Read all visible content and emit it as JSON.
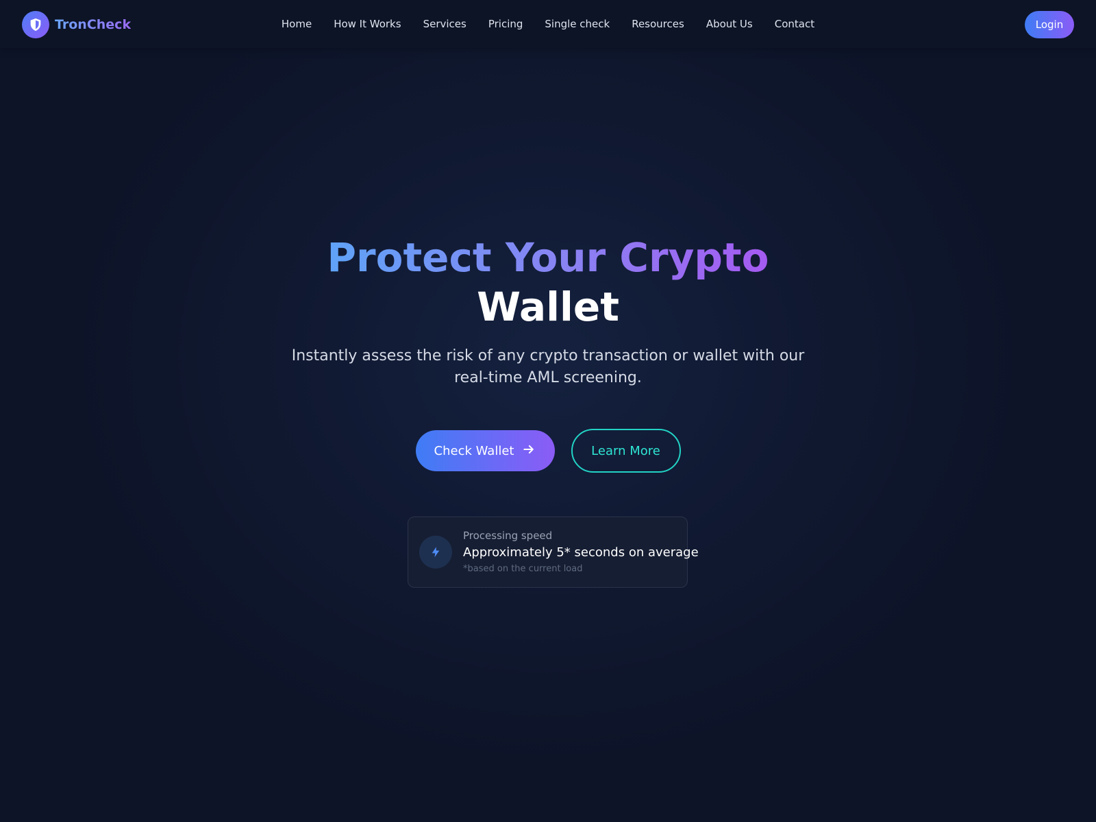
{
  "brand": {
    "name": "TronCheck"
  },
  "nav": {
    "links": [
      {
        "label": "Home"
      },
      {
        "label": "How It Works"
      },
      {
        "label": "Services"
      },
      {
        "label": "Pricing"
      },
      {
        "label": "Single check"
      },
      {
        "label": "Resources"
      },
      {
        "label": "About Us"
      },
      {
        "label": "Contact"
      }
    ],
    "login_label": "Login"
  },
  "hero": {
    "title_line1": "Protect Your Crypto",
    "title_line2": "Wallet",
    "subtitle": "Instantly assess the risk of any crypto transaction or wallet with our real-time AML screening.",
    "primary_cta": "Check Wallet",
    "secondary_cta": "Learn More"
  },
  "speed_card": {
    "label": "Processing speed",
    "value": "Approximately 5* seconds on average",
    "note": "*based on the current load"
  },
  "icons": {
    "brand": "shield-icon",
    "cta": "arrow-right-icon",
    "speed": "lightning-bolt-icon"
  },
  "colors": {
    "background": "#111a33",
    "accent_blue": "#3f7cf5",
    "accent_purple": "#8b5cf6",
    "accent_teal": "#22d3c5"
  }
}
